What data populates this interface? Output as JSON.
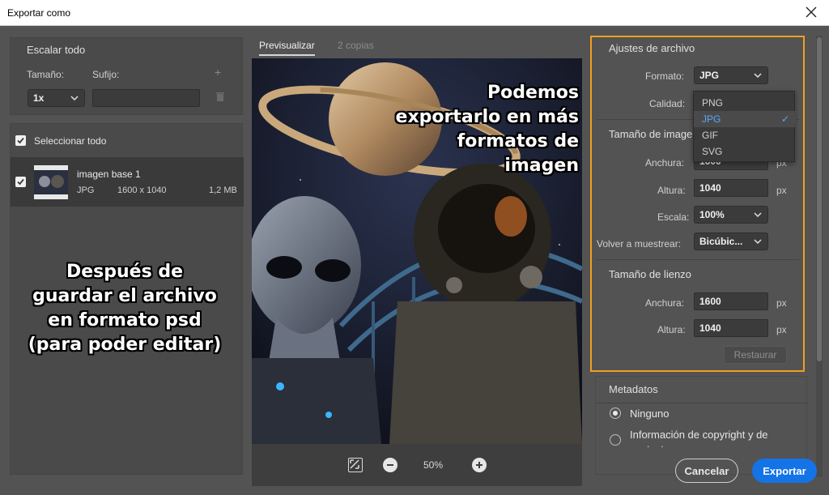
{
  "window": {
    "title": "Exportar como"
  },
  "left": {
    "scale_all": {
      "title": "Escalar todo",
      "size_label": "Tamaño:",
      "suffix_label": "Sufijo:",
      "size_value": "1x",
      "suffix_value": ""
    },
    "select_all": "Seleccionar todo",
    "asset": {
      "name": "imagen base 1",
      "format": "JPG",
      "dimensions": "1600 x 1040",
      "size": "1,2 MB"
    },
    "annotation": "Después de guardar el archivo en formato psd (para poder editar)"
  },
  "preview": {
    "tabs": [
      "Previsualizar",
      "2 copias"
    ],
    "annotation": "Podemos exportarlo en más formatos de imagen",
    "zoom": "50%"
  },
  "settings": {
    "file": {
      "title": "Ajustes de archivo",
      "format_label": "Formato:",
      "format_value": "JPG",
      "quality_label": "Calidad:",
      "options": [
        "PNG",
        "JPG",
        "GIF",
        "SVG"
      ],
      "selected": "JPG"
    },
    "image_size": {
      "title": "Tamaño de image",
      "width_label": "Anchura:",
      "width_value": "1600",
      "height_label": "Altura:",
      "height_value": "1040",
      "scale_label": "Escala:",
      "scale_value": "100%",
      "resample_label": "Volver a muestrear:",
      "resample_value": "Bicúbic...",
      "unit": "px"
    },
    "canvas_size": {
      "title": "Tamaño de lienzo",
      "width_label": "Anchura:",
      "width_value": "1600",
      "height_label": "Altura:",
      "height_value": "1040",
      "unit": "px",
      "restore_label": "Restaurar"
    },
    "metadata": {
      "title": "Metadatos",
      "option_none": "Ninguno",
      "option_copyright": "Información de copyright y de contacto"
    }
  },
  "buttons": {
    "cancel": "Cancelar",
    "export": "Exportar"
  },
  "colors": {
    "accent": "#1473e6",
    "highlight_frame": "#f0a020",
    "panel_bg": "#535353"
  }
}
